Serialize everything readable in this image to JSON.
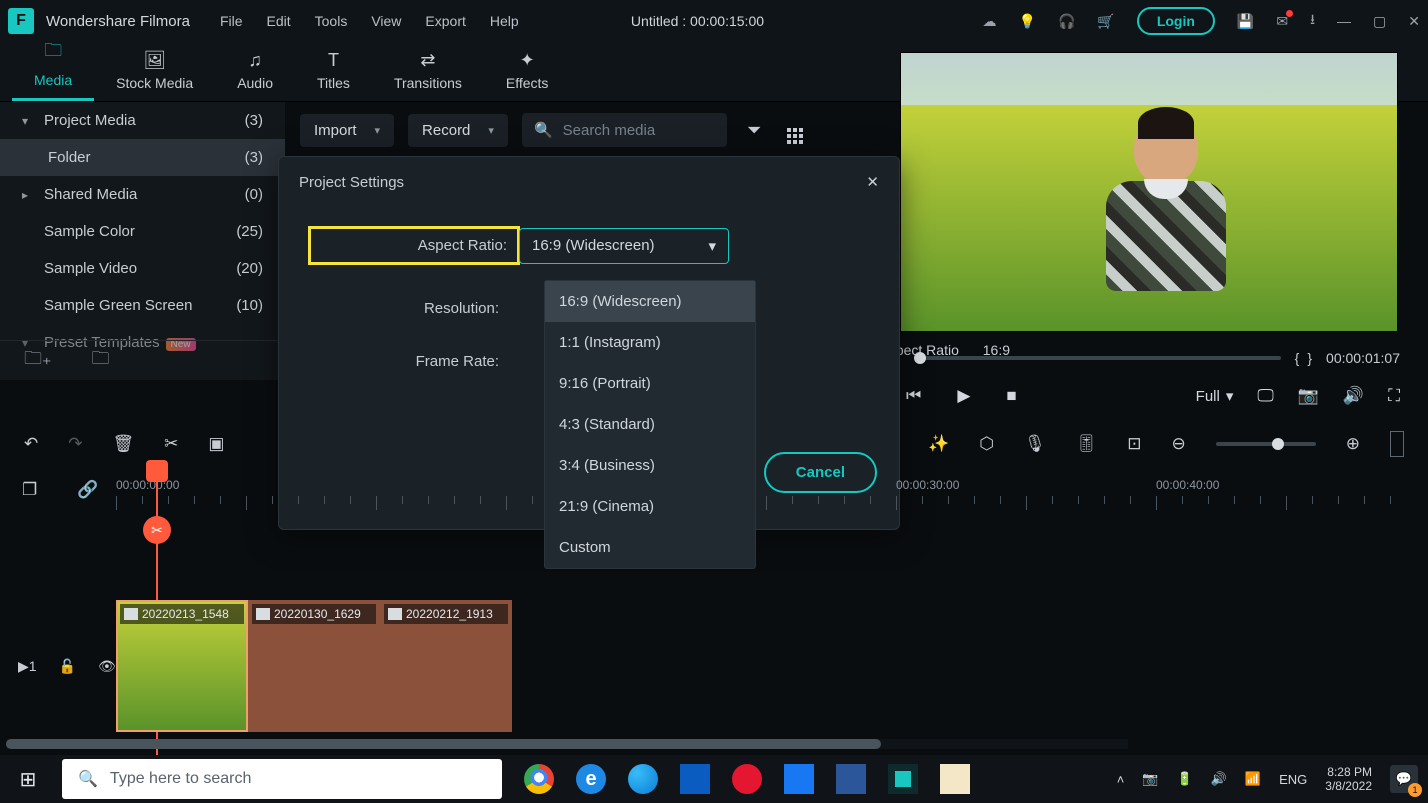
{
  "app": {
    "title": "Wondershare Filmora",
    "doc_title": "Untitled : 00:00:15:00",
    "login": "Login"
  },
  "menu": [
    "File",
    "Edit",
    "Tools",
    "View",
    "Export",
    "Help"
  ],
  "tabs": [
    {
      "icon": "folder",
      "label": "Media"
    },
    {
      "icon": "image",
      "label": "Stock Media"
    },
    {
      "icon": "note",
      "label": "Audio"
    },
    {
      "icon": "T",
      "label": "Titles"
    },
    {
      "icon": "swap",
      "label": "Transitions"
    },
    {
      "icon": "spark",
      "label": "Effects"
    }
  ],
  "export_label": "Export",
  "side": {
    "items": [
      {
        "label": "Project Media",
        "count": "(3)",
        "chev": "▾"
      },
      {
        "label": "Folder",
        "count": "(3)",
        "sub": true,
        "selected": true
      },
      {
        "label": "Shared Media",
        "count": "(0)",
        "chev": "▸"
      },
      {
        "label": "Sample Color",
        "count": "(25)"
      },
      {
        "label": "Sample Video",
        "count": "(20)"
      },
      {
        "label": "Sample Green Screen",
        "count": "(10)"
      },
      {
        "label": "Preset Templates",
        "count": "",
        "chev": "▾",
        "badge": "New"
      }
    ]
  },
  "import_row": {
    "import": "Import",
    "record": "Record",
    "search_ph": "Search media"
  },
  "modal": {
    "title": "Project Settings",
    "aspect_label": "Aspect Ratio:",
    "aspect_value": "16:9 (Widescreen)",
    "resolution_label": "Resolution:",
    "framerate_label": "Frame Rate:",
    "cancel": "Cancel",
    "options": [
      "16:9 (Widescreen)",
      "1:1 (Instagram)",
      "9:16 (Portrait)",
      "4:3 (Standard)",
      "3:4 (Business)",
      "21:9 (Cinema)",
      "Custom"
    ]
  },
  "preview": {
    "aspect_lbl": "Aspect Ratio",
    "aspect_val": "16:9",
    "braces_l": "{",
    "braces_r": "}",
    "timecode": "00:00:01:07",
    "full": "Full"
  },
  "ruler": {
    "labels": [
      {
        "pos": 0,
        "text": "00:00:00:00"
      },
      {
        "pos": 780,
        "text": "00:00:30:00"
      },
      {
        "pos": 1040,
        "text": "00:00:40:00"
      }
    ]
  },
  "clips": [
    {
      "name": "20220213_1548",
      "sel": true
    },
    {
      "name": "20220130_1629"
    },
    {
      "name": "20220212_1913"
    }
  ],
  "track": {
    "num": "1"
  },
  "taskbar": {
    "search_ph": "Type here to search",
    "lang": "ENG",
    "time": "8:28 PM",
    "date": "3/8/2022"
  },
  "icons": {
    "close": "✕"
  }
}
